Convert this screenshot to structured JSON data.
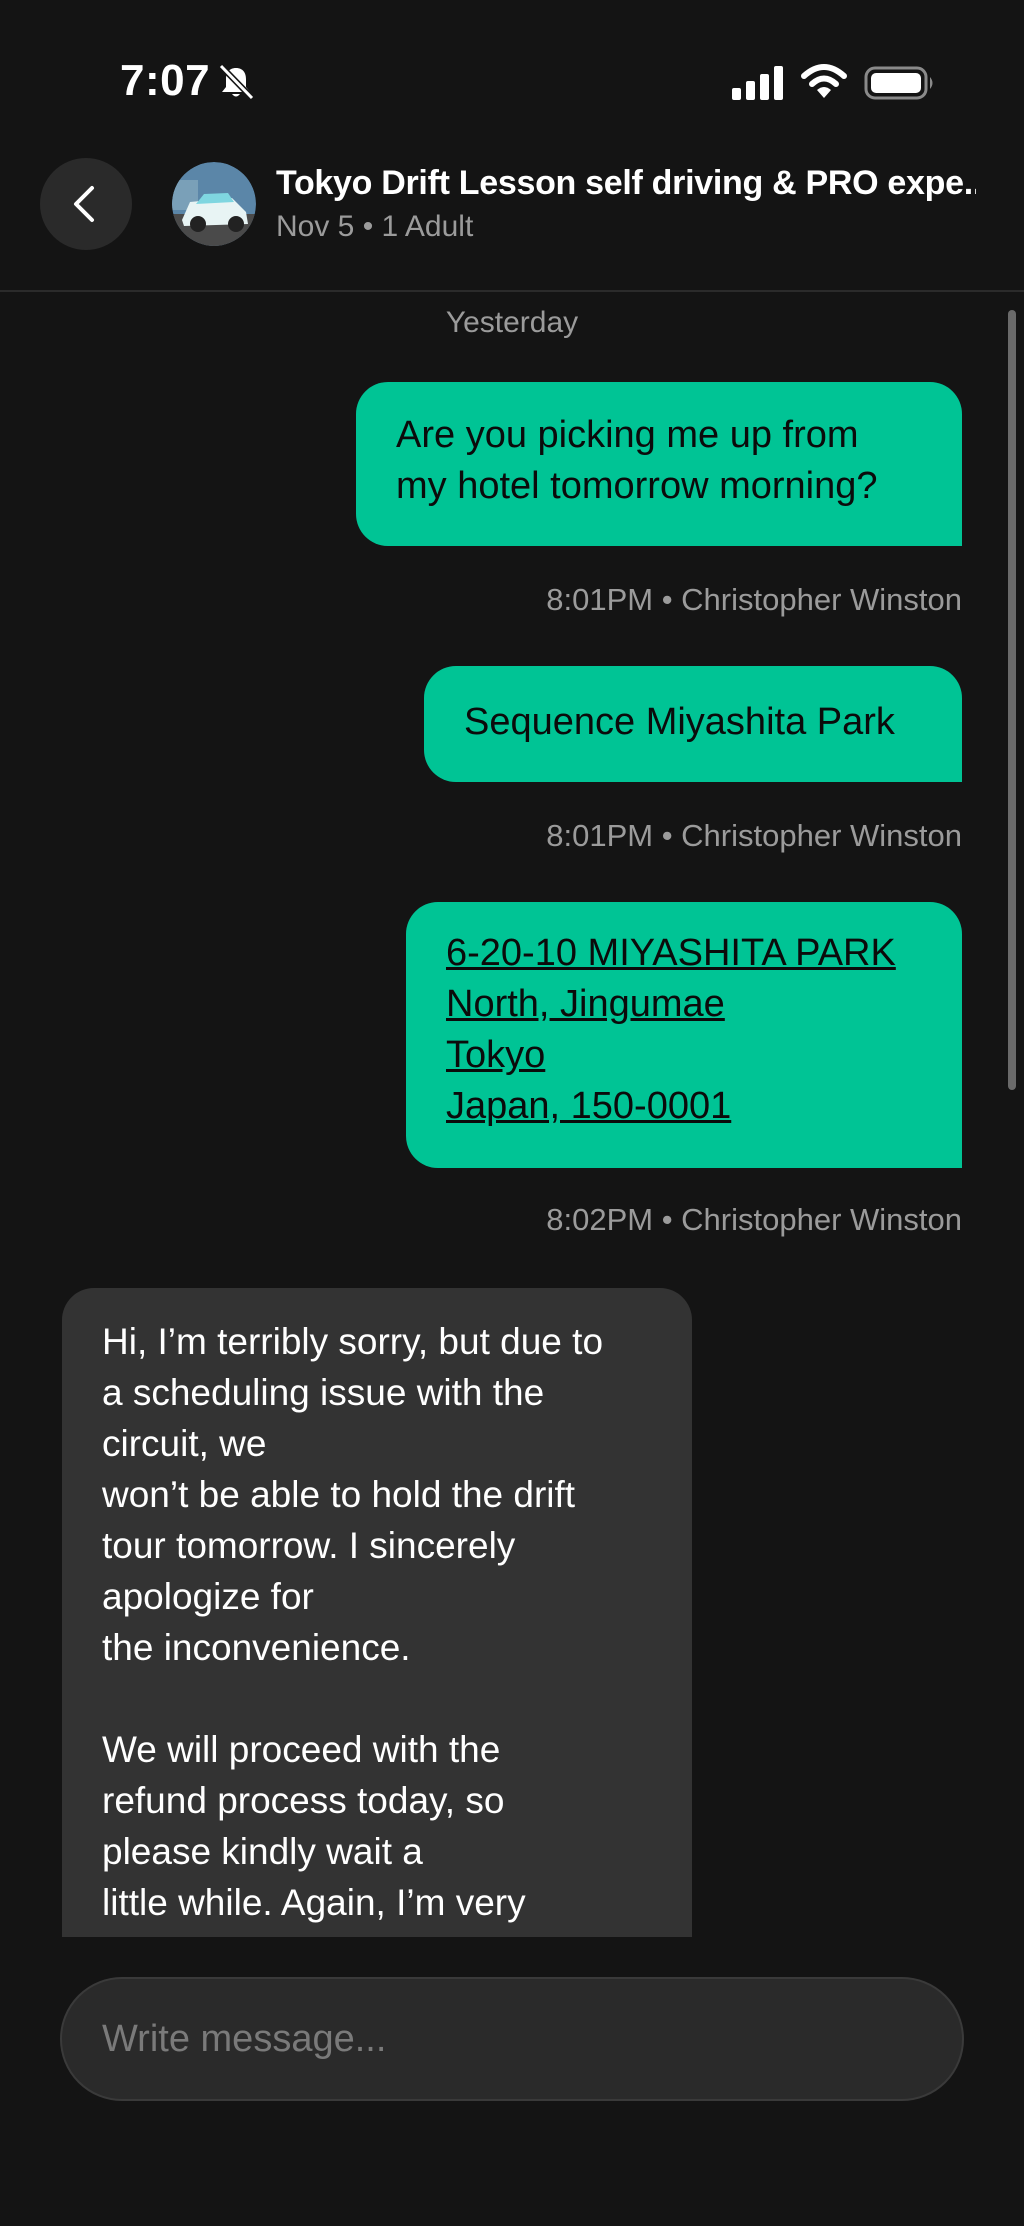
{
  "status_bar": {
    "time": "7:07",
    "icons": [
      "bell-slash-icon",
      "signal-icon",
      "wifi-icon",
      "battery-icon"
    ]
  },
  "header": {
    "title": "Tokyo Drift Lesson self driving & PRO expe...",
    "subtitle": "Nov 5 • 1 Adult",
    "back_icon": "chevron-left-icon"
  },
  "chat": {
    "day_label": "Yesterday",
    "messages": [
      {
        "direction": "outgoing",
        "lines": [
          "Are you picking me up from",
          "my hotel tomorrow morning?"
        ],
        "meta": "8:01PM • Christopher Winston"
      },
      {
        "direction": "outgoing",
        "lines": [
          "Sequence Miyashita Park"
        ],
        "meta": "8:01PM • Christopher Winston"
      },
      {
        "direction": "outgoing",
        "link": true,
        "lines": [
          "6-20-10 MIYASHITA PARK",
          "North, Jingumae",
          "Tokyo",
          "Japan, 150-0001"
        ],
        "meta": "8:02PM • Christopher Winston"
      },
      {
        "direction": "incoming",
        "lines": [
          "Hi, I’m terribly sorry, but due to",
          "a scheduling issue with the",
          "circuit, we",
          "won’t be able to hold the drift",
          "tour tomorrow. I sincerely",
          "apologize for",
          "the inconvenience.",
          "",
          "We will proceed with the",
          "refund process today, so",
          "please kindly wait a",
          "little while. Again, I’m very"
        ]
      }
    ]
  },
  "composer": {
    "placeholder": "Write message..."
  },
  "colors": {
    "background": "#141414",
    "outgoing_bubble": "#00c495",
    "incoming_bubble": "#333333",
    "secondary_text": "#9b9b9b"
  }
}
